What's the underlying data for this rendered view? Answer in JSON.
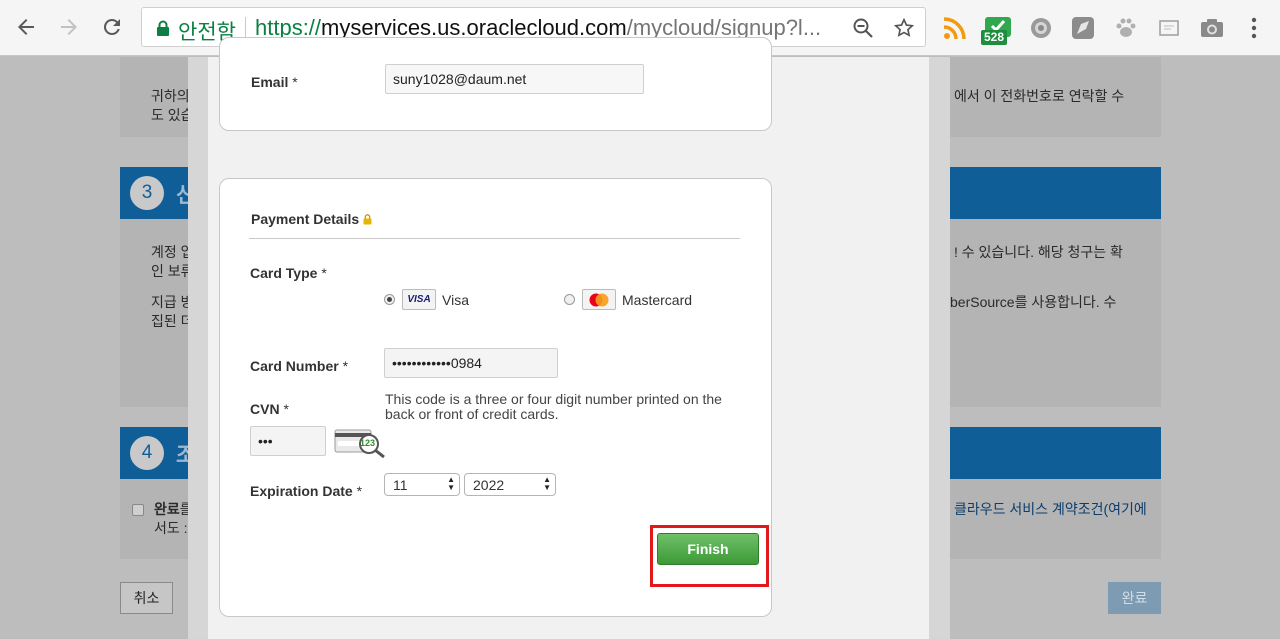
{
  "browser": {
    "secure_label": "안전함",
    "url_protocol": "https://",
    "url_host": "myservices.us.oraclecloud.com",
    "url_path": "/mycloud/signup?l...",
    "extension_badge": "528"
  },
  "background_page": {
    "para1_line1": "귀하의",
    "para1_line2": "도 있습",
    "para1_right": "에서 이 전화번호로 연락할 수",
    "section3_number": "3",
    "section3_heading": "신",
    "para2_line1": "계정 업",
    "para2_line2": "인 보류",
    "para2_right": "! 수 있습니다. 해당 청구는 확",
    "para3_line1": "지급 방",
    "para3_line2": "집된 더",
    "para3_right": "berSource를 사용합니다. 수",
    "section4_number": "4",
    "section4_heading": "조",
    "agree_bold": "완료",
    "agree_rest": "를",
    "agree_line2": "서도 :",
    "agree_right": "클라우드 서비스 계약조건(여기에",
    "cancel_label": "취소",
    "complete_label": "완료"
  },
  "modal": {
    "email": {
      "label": "Email",
      "required": " *",
      "value": "suny1028@daum.net"
    },
    "payment": {
      "heading": "Payment Details",
      "card_type_label": "Card Type",
      "card_types": [
        {
          "label": "Visa",
          "selected": true,
          "logo": "VISA"
        },
        {
          "label": "Mastercard",
          "selected": false,
          "logo": "mastercard-icon"
        }
      ],
      "card_number_label": "Card Number",
      "card_number_value": "••••••••••••0984",
      "cvn_label": "CVN",
      "cvn_value": "•••",
      "cvn_hint": "This code is a three or four digit number printed on the back or front of credit cards.",
      "cvn_image_text": "123",
      "expiration_label": "Expiration Date",
      "expiration_month": "11",
      "expiration_year": "2022",
      "required": " *",
      "finish_label": "Finish"
    }
  },
  "colors": {
    "accent_blue": "#0f5e98",
    "finish_green": "#4caa45",
    "highlight_red": "#e2181c",
    "secure_green": "#0b8043"
  }
}
